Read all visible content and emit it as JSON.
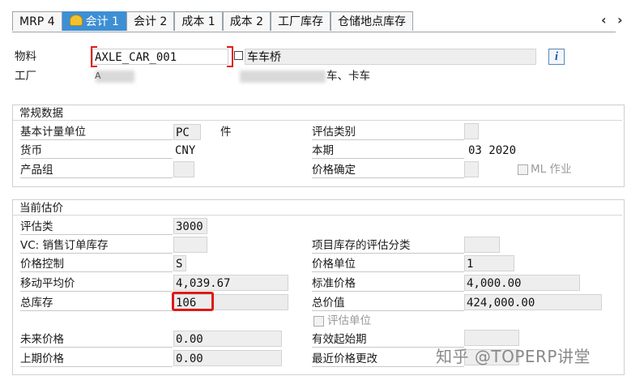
{
  "tabs": [
    {
      "label": "MRP 4"
    },
    {
      "label": "会计 1"
    },
    {
      "label": "会计 2"
    },
    {
      "label": "成本 1"
    },
    {
      "label": "成本 2"
    },
    {
      "label": "工厂库存"
    },
    {
      "label": "仓储地点库存"
    }
  ],
  "nav": {
    "prev": "‹",
    "next": "›"
  },
  "header": {
    "material_label": "物料",
    "material_value": "AXLE_CAR_001",
    "material_desc": "车车桥",
    "plant_label": "工厂",
    "plant_value": "A",
    "plant_desc": "车、卡车",
    "info_icon": "i"
  },
  "general": {
    "title": "常规数据",
    "base_uom_label": "基本计量单位",
    "base_uom_value": "PC",
    "base_uom_text": "件",
    "valuation_category_label": "评估类别",
    "valuation_category_value": "",
    "currency_label": "货币",
    "currency_value": "CNY",
    "period_label": "本期",
    "period_value": "03 2020",
    "product_group_label": "产品组",
    "product_group_value": "",
    "price_determination_label": "价格确定",
    "price_determination_value": "",
    "ml_label": "ML 作业"
  },
  "valuation": {
    "title": "当前估价",
    "valuation_class_label": "评估类",
    "valuation_class_value": "3000",
    "vc_label": "VC: 销售订单库存",
    "vc_value": "",
    "proj_label": "项目库存的评估分类",
    "proj_value": "",
    "price_control_label": "价格控制",
    "price_control_value": "S",
    "price_unit_label": "价格单位",
    "price_unit_value": "1",
    "map_label": "移动平均价",
    "map_value": "4,039.67",
    "std_price_label": "标准价格",
    "std_price_value": "4,000.00",
    "total_stock_label": "总库存",
    "total_stock_value": "106",
    "total_value_label": "总价值",
    "total_value_value": "424,000.00",
    "valuation_unit_label": "评估单位",
    "future_price_label": "未来价格",
    "future_price_value": "0.00",
    "valid_from_label": "有效起始期",
    "valid_from_value": "",
    "prev_price_label": "上期价格",
    "prev_price_value": "0.00",
    "last_change_label": "最近价格更改",
    "last_change_value": ""
  },
  "watermark": "知乎 @TOPERP讲堂",
  "colors": {
    "accent": "#3d8fd4",
    "highlight": "#e01818"
  }
}
